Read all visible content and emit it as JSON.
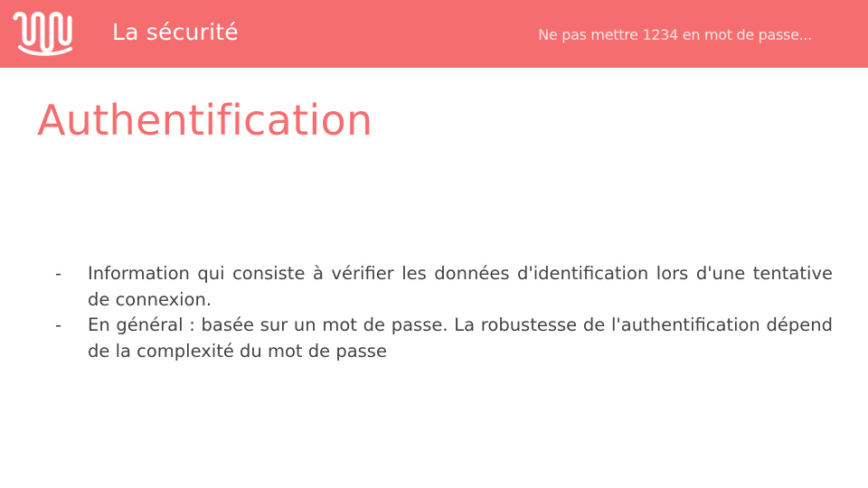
{
  "header": {
    "logo_icon": "wavy-u-logo-icon",
    "title": "La sécurité",
    "subtitle": "Ne pas mettre 1234 en mot de passe..."
  },
  "slide": {
    "title": "Authentification",
    "bullets": [
      {
        "marker": "-",
        "text": "Information qui consiste à vérifier les données d'identification lors d'une tentative de connexion."
      },
      {
        "marker": "-",
        "text": "En général : basée sur un mot de passe. La robustesse de l'authentification dépend de la complexité du mot de passe"
      }
    ]
  },
  "colors": {
    "accent": "#f66d6f",
    "header_text": "#ffffff",
    "body_text": "#434343",
    "background": "#ffffff"
  }
}
